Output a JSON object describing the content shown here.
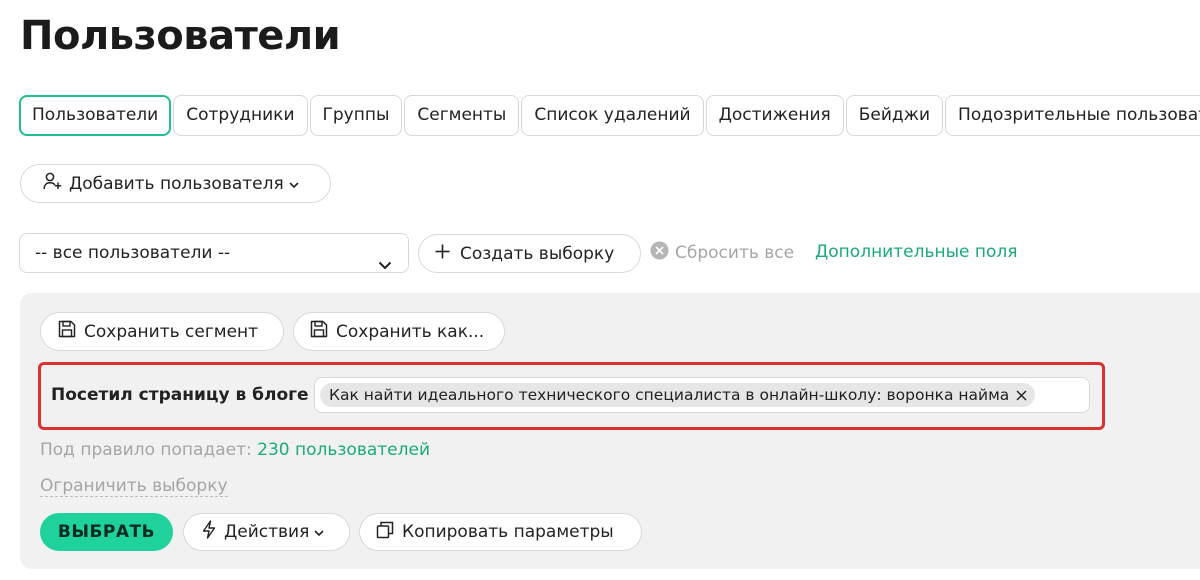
{
  "page": {
    "title": "Пользователи"
  },
  "tabs": [
    {
      "label": "Пользователи",
      "active": true
    },
    {
      "label": "Сотрудники",
      "active": false
    },
    {
      "label": "Группы",
      "active": false
    },
    {
      "label": "Сегменты",
      "active": false
    },
    {
      "label": "Список удалений",
      "active": false
    },
    {
      "label": "Достижения",
      "active": false
    },
    {
      "label": "Бейджи",
      "active": false
    },
    {
      "label": "Подозрительные пользователи",
      "active": false
    }
  ],
  "toolbar": {
    "add_user_label": "Добавить пользователя",
    "add_user_icon": "user-plus-icon"
  },
  "filter": {
    "segment_select_value": "-- все пользователи --",
    "create_selection_label": "Создать выборку",
    "reset_all_label": "Сбросить все",
    "extra_fields_label": "Дополнительные поля"
  },
  "panel": {
    "save_segment_label": "Сохранить сегмент",
    "save_as_label": "Сохранить как...",
    "rule": {
      "label": "Посетил страницу в блоге",
      "tags": [
        "Как найти идеального технического специалиста в онлайн-школу: воронка найма"
      ]
    },
    "rule_count_prefix": "Под правило попадает:",
    "rule_count_link": "230 пользователей",
    "limit_selection_label": "Ограничить выборку",
    "select_button_label": "ВЫБРАТЬ",
    "actions_label": "Действия",
    "copy_params_label": "Копировать параметры"
  },
  "colors": {
    "accent": "#1fd19b",
    "link": "#1aa97c",
    "highlight_border": "#dc3131",
    "panel_bg": "#f1f1f1",
    "muted_text": "#a5a5a5"
  }
}
